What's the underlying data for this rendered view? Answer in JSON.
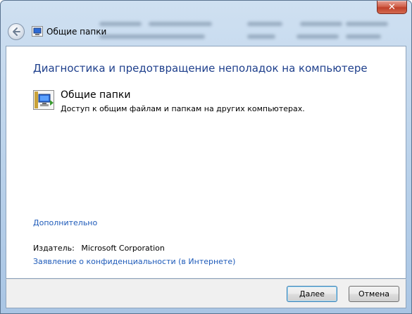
{
  "window": {
    "title": "Общие папки",
    "close_glyph": "✕"
  },
  "content": {
    "heading": "Диагностика и предотвращение неполадок на компьютере",
    "item": {
      "title": "Общие папки",
      "description": "Доступ к общим файлам и папкам на других компьютерах.",
      "icon": "shared-folders-icon"
    },
    "advanced_link": "Дополнительно",
    "publisher_label": "Издатель:",
    "publisher_value": "Microsoft Corporation",
    "privacy_link": "Заявление о конфиденциальности (в Интернете)"
  },
  "footer": {
    "next_label_accel": "Д",
    "next_label_rest": "алее",
    "cancel_label": "Отмена"
  },
  "colors": {
    "heading": "#1e3f8c",
    "link": "#1d5ab9",
    "close_button": "#c0412a"
  }
}
